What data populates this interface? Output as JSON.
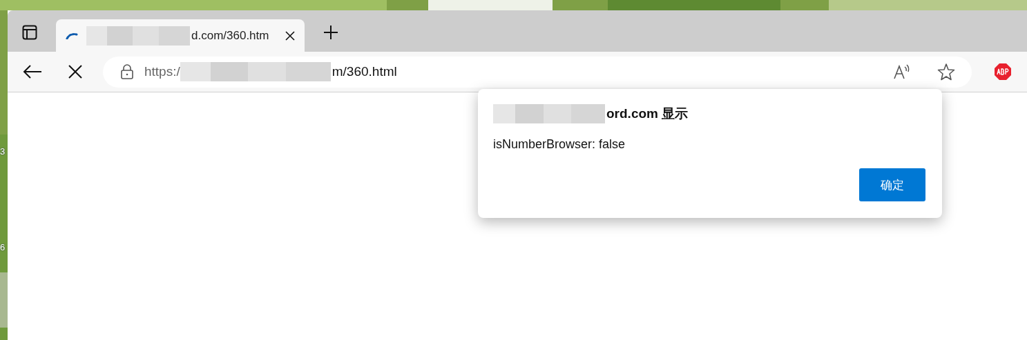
{
  "desktop_labels": [
    "3",
    "6"
  ],
  "tabs": [
    {
      "title": "d.com/360.htm",
      "loading": true,
      "selected": true
    }
  ],
  "address_bar": {
    "url_start": "https:/",
    "url_end": "m/360.html"
  },
  "dialog": {
    "title": "ord.com 显示",
    "message": "isNumberBrowser: false",
    "buttons": [
      {
        "label": "确定"
      }
    ]
  }
}
